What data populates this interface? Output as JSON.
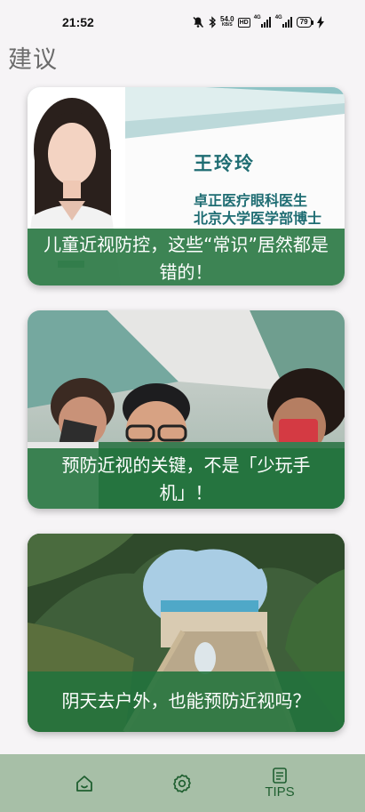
{
  "status_bar": {
    "time": "21:52",
    "net_speed_value": "54.0",
    "net_speed_unit": "KB/S",
    "hd_label": "HD",
    "signal1_label": "4G",
    "signal2_label": "4G",
    "battery_level": "79",
    "icons": [
      "mute-icon",
      "bluetooth-icon",
      "hd-icon",
      "signal-icon",
      "signal-icon",
      "battery-icon",
      "charging-icon"
    ]
  },
  "page": {
    "title": "建议"
  },
  "articles": [
    {
      "title": "儿童近视防控，这些“常识”居然都是错的！",
      "banner_name": "王玲玲",
      "banner_lines": [
        "卓正医疗眼科医生",
        "北京大学医学部博士"
      ]
    },
    {
      "title": "预防近视的关键，不是「少玩手机」！"
    },
    {
      "title": "阴天去户外，也能预防近视吗？"
    }
  ],
  "tabbar": {
    "items": [
      {
        "icon": "home-icon",
        "label": ""
      },
      {
        "icon": "settings-icon",
        "label": ""
      },
      {
        "icon": "tips-icon",
        "label": "TIPS"
      }
    ]
  },
  "colors": {
    "background": "#f6f4f6",
    "caption_overlay": "#22733c",
    "tabbar": "#a7bfa7",
    "tab_icon": "#1f5f30",
    "banner_text": "#1f6d73"
  }
}
